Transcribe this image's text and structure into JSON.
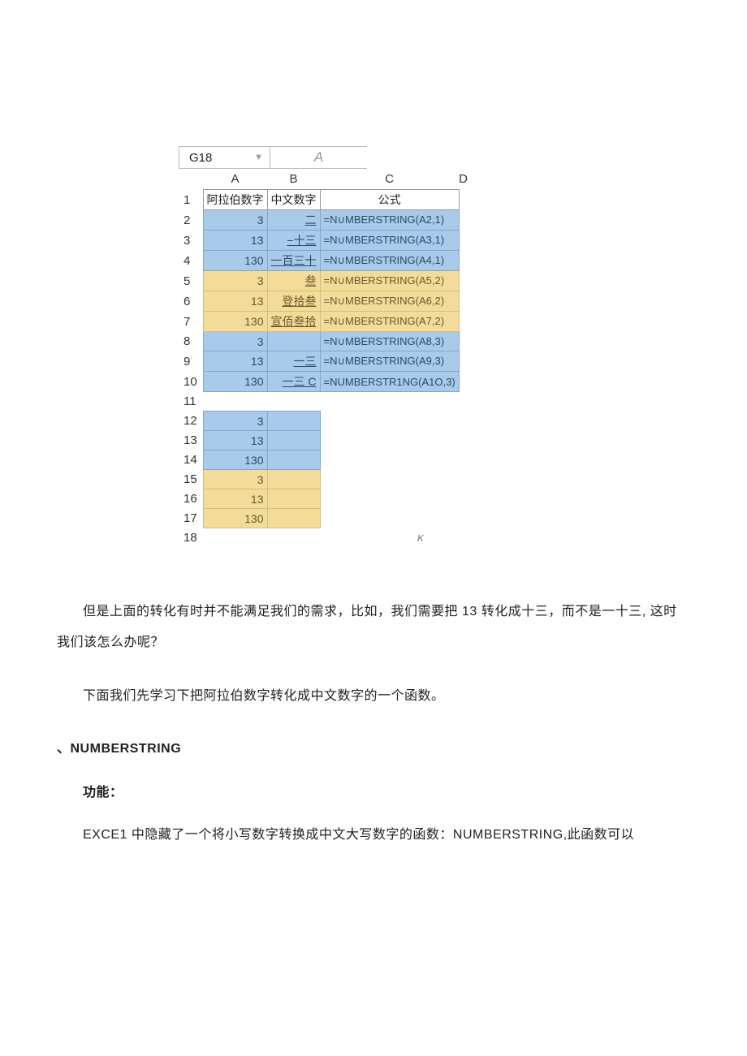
{
  "name_box": "G18",
  "fx_label": "A",
  "col_headers": [
    "A",
    "B",
    "C",
    "D"
  ],
  "r1": {
    "a": "阿拉伯数字",
    "b": "中文数字",
    "c": "公式"
  },
  "rows": [
    {
      "n": "2",
      "a": "3",
      "b": "二",
      "c": "=N∪MBERSTRING(A2,1)",
      "cls": "blue"
    },
    {
      "n": "3",
      "a": "13",
      "b": "−十三",
      "c": "=N∪MBERSTRING(A3,1)",
      "cls": "blue"
    },
    {
      "n": "4",
      "a": "130",
      "b": "一百三十",
      "c": "=N∪MBERSTRING(A4,1)",
      "cls": "blue"
    },
    {
      "n": "5",
      "a": "3",
      "b": "叁",
      "c": "=N∪MBERSTRING(A5,2)",
      "cls": "yellow"
    },
    {
      "n": "6",
      "a": "13",
      "b": "登拾叁",
      "c": "=N∪MBERSTRING(A6,2)",
      "cls": "yellow"
    },
    {
      "n": "7",
      "a": "130",
      "b": "宣佰叁拾",
      "c": "=N∪MBERSTRING(A7,2)",
      "cls": "yellow"
    },
    {
      "n": "8",
      "a": "3",
      "b": "",
      "c": "=N∪MBERSTRING(A8,3)",
      "cls": "blue"
    },
    {
      "n": "9",
      "a": "13",
      "b": "一三",
      "c": "=N∪MBERSTRING(A9,3)",
      "cls": "blue"
    },
    {
      "n": "10",
      "a": "130",
      "b": "一三 C",
      "c": "=NUMBERSTR1NG(A1O,3)",
      "cls": "blue"
    }
  ],
  "rows2": [
    {
      "n": "12",
      "a": "3",
      "cls": "blue"
    },
    {
      "n": "13",
      "a": "13",
      "cls": "blue"
    },
    {
      "n": "14",
      "a": "130",
      "cls": "blue"
    },
    {
      "n": "15",
      "a": "3",
      "cls": "yellow"
    },
    {
      "n": "16",
      "a": "13",
      "cls": "yellow"
    },
    {
      "n": "17",
      "a": "130",
      "cls": "yellow"
    }
  ],
  "row11": "11",
  "row18": "18",
  "italic_k": "κ",
  "para1": "但是上面的转化有时并不能满足我们的需求，比如，我们需要把 13 转化成十三，而不是一十三, 这时我们该怎么办呢？",
  "para2": "下面我们先学习下把阿拉伯数字转化成中文数字的一个函数。",
  "sec_title": "、NUMBERSTRING",
  "sub_title": "功能：",
  "para3": "EXCE1 中隐藏了一个将小写数字转换成中文大写数字的函数：NUMBERSTRING,此函数可以"
}
